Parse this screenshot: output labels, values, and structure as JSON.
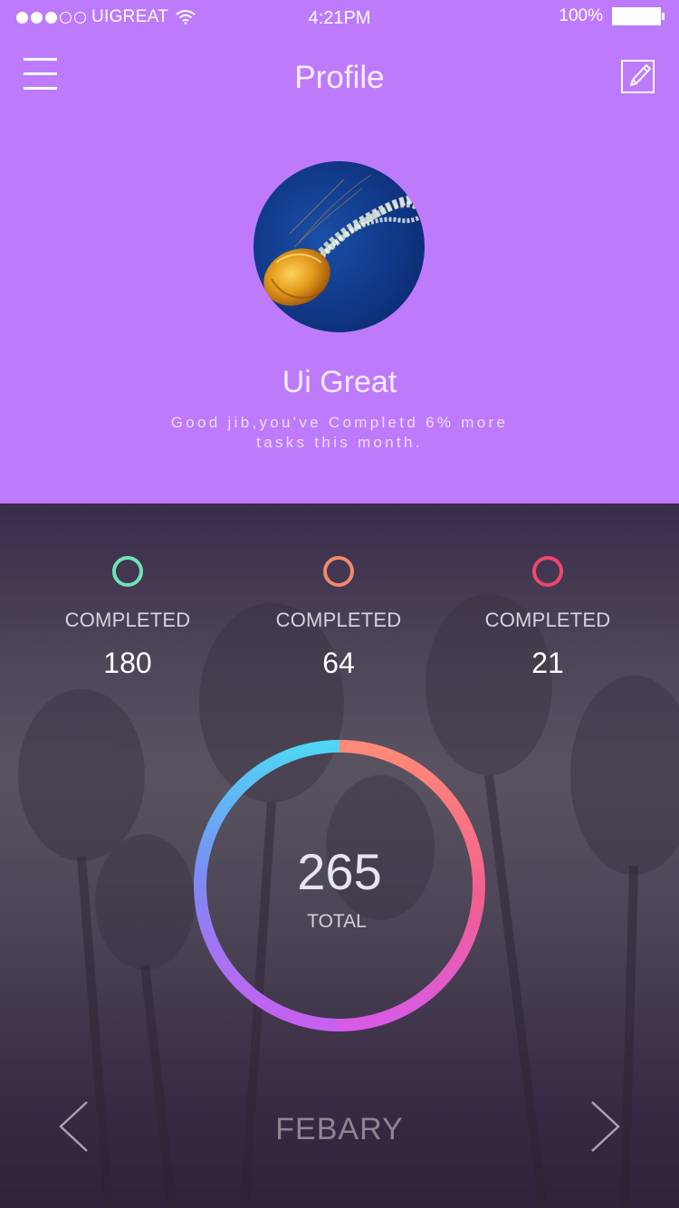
{
  "status_bar": {
    "carrier": "UIGREAT",
    "time": "4:21PM",
    "battery": "100%",
    "signal_filled": 3,
    "signal_total": 5
  },
  "header": {
    "title": "Profile",
    "menu_icon": "hamburger-menu-icon",
    "edit_icon": "edit-pencil-icon"
  },
  "profile": {
    "name": "Ui Great",
    "message_line1": "Good jib,you've Completd 6% more",
    "message_line2": "tasks this month.",
    "avatar_image": "jellyfish photo"
  },
  "stats": [
    {
      "label": "COMPLETED",
      "value": "180",
      "color": "#6fe3b8"
    },
    {
      "label": "COMPLETED",
      "value": "64",
      "color": "#f08a6a"
    },
    {
      "label": "COMPLETED",
      "value": "21",
      "color": "#f0466e"
    }
  ],
  "summary": {
    "total": "265",
    "total_label": "TOTAL",
    "ring_gradient": [
      "#4fd6f5",
      "#7b8cf5",
      "#c760f0",
      "#f25f8f",
      "#ff8a78"
    ]
  },
  "footer": {
    "month": "FEBARY",
    "prev_icon": "chevron-left-icon",
    "next_icon": "chevron-right-icon"
  },
  "colors": {
    "header_background": "#bd7bfc",
    "bottom_background": "#4e4658"
  }
}
